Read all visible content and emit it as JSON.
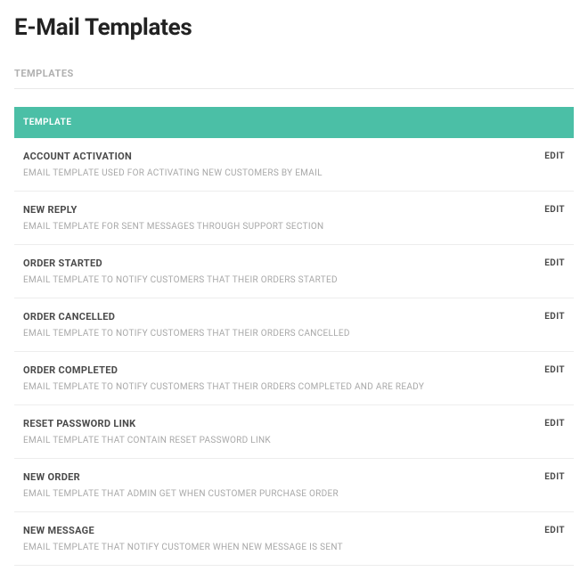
{
  "pageTitle": "E-Mail Templates",
  "sectionLabel": "TEMPLATES",
  "tableHeader": "TEMPLATE",
  "editLabel": "EDIT",
  "templates": [
    {
      "title": "ACCOUNT ACTIVATION",
      "description": "EMAIL TEMPLATE USED FOR ACTIVATING NEW CUSTOMERS BY EMAIL"
    },
    {
      "title": "NEW REPLY",
      "description": "EMAIL TEMPLATE FOR SENT MESSAGES THROUGH SUPPORT SECTION"
    },
    {
      "title": "ORDER STARTED",
      "description": "EMAIL TEMPLATE TO NOTIFY CUSTOMERS THAT THEIR ORDERS STARTED"
    },
    {
      "title": "ORDER CANCELLED",
      "description": "EMAIL TEMPLATE TO NOTIFY CUSTOMERS THAT THEIR ORDERS CANCELLED"
    },
    {
      "title": "ORDER COMPLETED",
      "description": "EMAIL TEMPLATE TO NOTIFY CUSTOMERS THAT THEIR ORDERS COMPLETED AND ARE READY"
    },
    {
      "title": "RESET PASSWORD LINK",
      "description": "EMAIL TEMPLATE THAT CONTAIN RESET PASSWORD LINK"
    },
    {
      "title": "NEW ORDER",
      "description": "EMAIL TEMPLATE THAT ADMIN GET WHEN CUSTOMER PURCHASE ORDER"
    },
    {
      "title": "NEW MESSAGE",
      "description": "EMAIL TEMPLATE THAT NOTIFY CUSTOMER WHEN NEW MESSAGE IS SENT"
    }
  ]
}
